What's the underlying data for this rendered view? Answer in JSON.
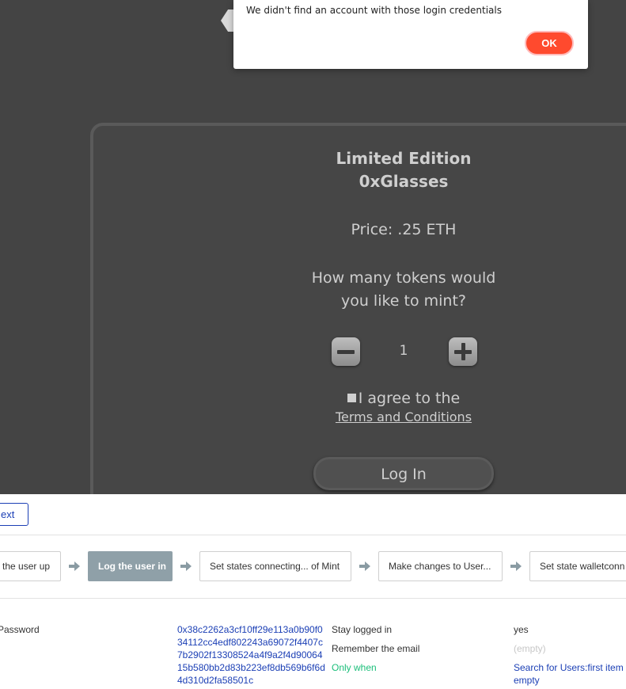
{
  "alert": {
    "message": "We didn't find an account with those login credentials",
    "ok_label": "OK"
  },
  "mint_card": {
    "title_line1": "Limited Edition",
    "title_line2": "0xGlasses",
    "price": "Price: .25 ETH",
    "question_line1": "How many tokens would",
    "question_line2": "you like to mint?",
    "quantity": "1",
    "agree_text": "I agree to the",
    "terms_link": "Terms and Conditions",
    "login_label": "Log In"
  },
  "editor": {
    "text_button_label": "ext",
    "workflow_steps": [
      {
        "label": "the user up",
        "active": false
      },
      {
        "label": "Log the user in",
        "active": true
      },
      {
        "label": "Set states connecting... of Mint",
        "active": false
      },
      {
        "label": "Make changes to User...",
        "active": false
      },
      {
        "label": "Set state walletconn",
        "active": false
      }
    ],
    "properties": {
      "password_label": "Password",
      "password_value": "0x38c2262a3cf10ff29e113a0b90f034112cc4edf802243a69072f4407c7b2902f13308524a4f9a2f4d9006415b580bb2d83b223ef8db569b6f6d4d310d2fa58501c",
      "stay_logged_in_label": "Stay logged in",
      "stay_logged_in_value": "yes",
      "remember_email_label": "Remember the email",
      "remember_email_value": "(empty)",
      "only_when_label": "Only when",
      "only_when_value": "Search for Users:first item empty"
    }
  }
}
